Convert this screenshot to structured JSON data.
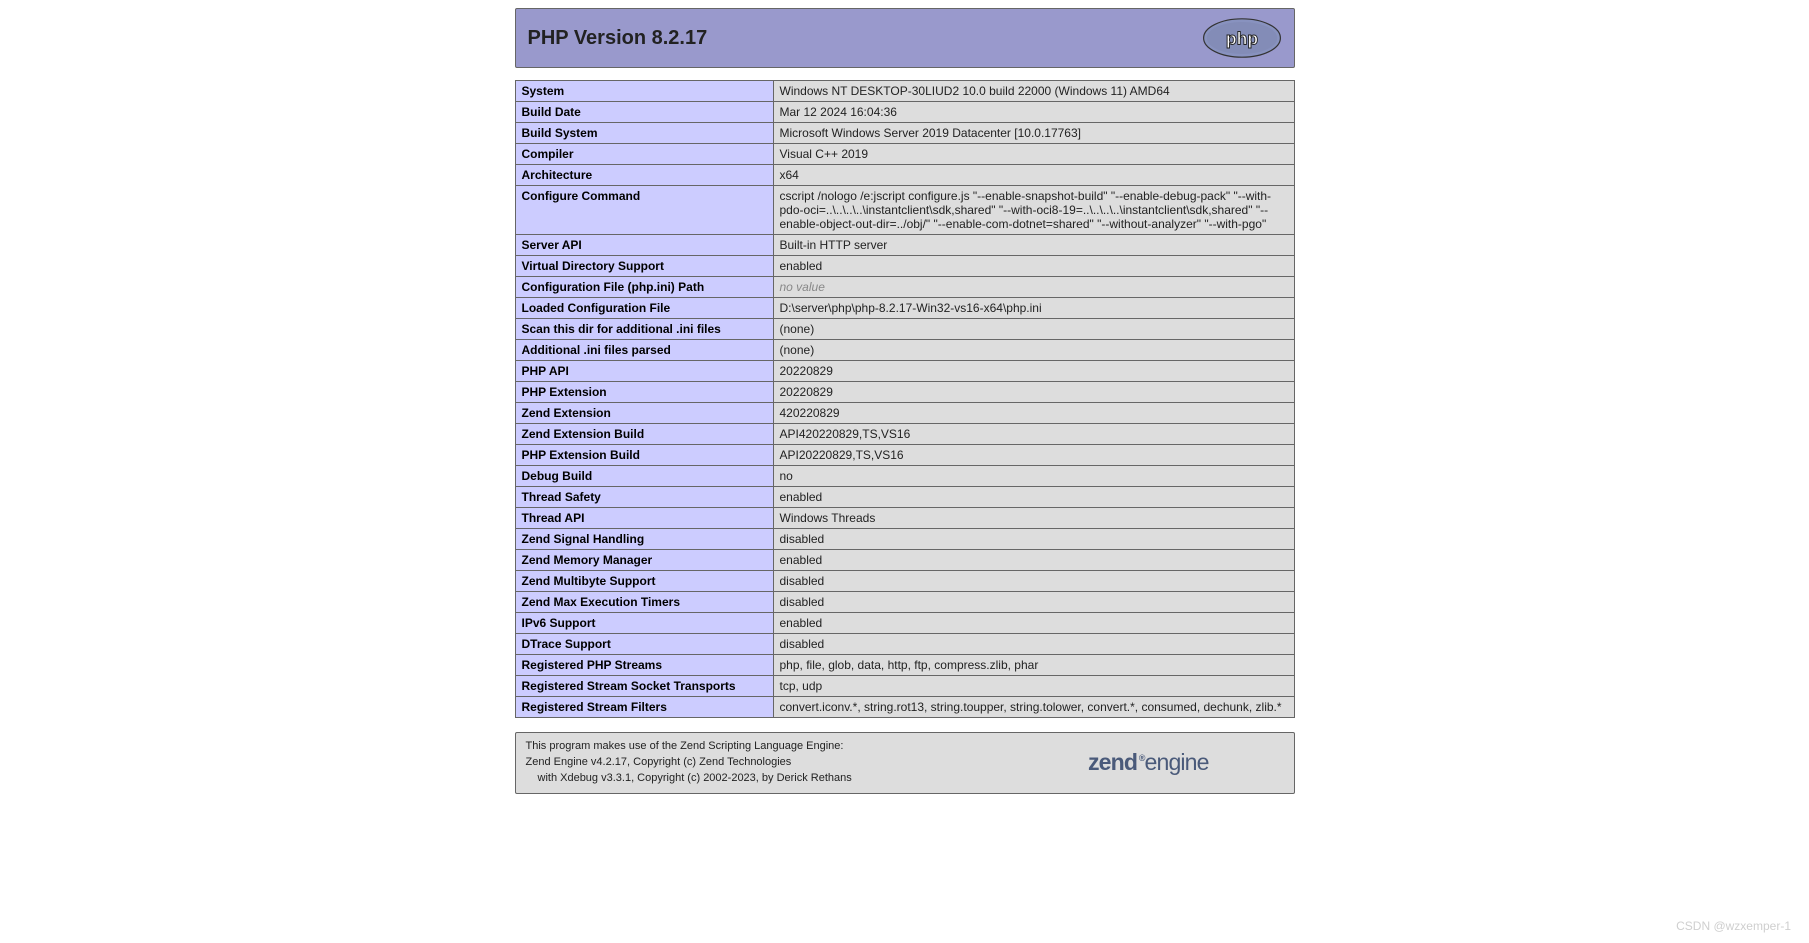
{
  "header": {
    "title": "PHP Version 8.2.17",
    "logo_text": "php"
  },
  "rows": [
    {
      "key": "System",
      "value": "Windows NT DESKTOP-30LIUD2 10.0 build 22000 (Windows 11) AMD64"
    },
    {
      "key": "Build Date",
      "value": "Mar 12 2024 16:04:36"
    },
    {
      "key": "Build System",
      "value": "Microsoft Windows Server 2019 Datacenter [10.0.17763]"
    },
    {
      "key": "Compiler",
      "value": "Visual C++ 2019"
    },
    {
      "key": "Architecture",
      "value": "x64"
    },
    {
      "key": "Configure Command",
      "value": "cscript /nologo /e:jscript configure.js \"--enable-snapshot-build\" \"--enable-debug-pack\" \"--with-pdo-oci=..\\..\\..\\..\\instantclient\\sdk,shared\" \"--with-oci8-19=..\\..\\..\\..\\instantclient\\sdk,shared\" \"--enable-object-out-dir=../obj/\" \"--enable-com-dotnet=shared\" \"--without-analyzer\" \"--with-pgo\""
    },
    {
      "key": "Server API",
      "value": "Built-in HTTP server"
    },
    {
      "key": "Virtual Directory Support",
      "value": "enabled"
    },
    {
      "key": "Configuration File (php.ini) Path",
      "value": "no value",
      "novalue": true
    },
    {
      "key": "Loaded Configuration File",
      "value": "D:\\server\\php\\php-8.2.17-Win32-vs16-x64\\php.ini"
    },
    {
      "key": "Scan this dir for additional .ini files",
      "value": "(none)"
    },
    {
      "key": "Additional .ini files parsed",
      "value": "(none)"
    },
    {
      "key": "PHP API",
      "value": "20220829"
    },
    {
      "key": "PHP Extension",
      "value": "20220829"
    },
    {
      "key": "Zend Extension",
      "value": "420220829"
    },
    {
      "key": "Zend Extension Build",
      "value": "API420220829,TS,VS16"
    },
    {
      "key": "PHP Extension Build",
      "value": "API20220829,TS,VS16"
    },
    {
      "key": "Debug Build",
      "value": "no"
    },
    {
      "key": "Thread Safety",
      "value": "enabled"
    },
    {
      "key": "Thread API",
      "value": "Windows Threads"
    },
    {
      "key": "Zend Signal Handling",
      "value": "disabled"
    },
    {
      "key": "Zend Memory Manager",
      "value": "enabled"
    },
    {
      "key": "Zend Multibyte Support",
      "value": "disabled"
    },
    {
      "key": "Zend Max Execution Timers",
      "value": "disabled"
    },
    {
      "key": "IPv6 Support",
      "value": "enabled"
    },
    {
      "key": "DTrace Support",
      "value": "disabled"
    },
    {
      "key": "Registered PHP Streams",
      "value": "php, file, glob, data, http, ftp, compress.zlib, phar"
    },
    {
      "key": "Registered Stream Socket Transports",
      "value": "tcp, udp"
    },
    {
      "key": "Registered Stream Filters",
      "value": "convert.iconv.*, string.rot13, string.toupper, string.tolower, convert.*, consumed, dechunk, zlib.*"
    }
  ],
  "zend": {
    "line1": "This program makes use of the Zend Scripting Language Engine:",
    "line2": "Zend Engine v4.2.17, Copyright (c) Zend Technologies",
    "line3": "with Xdebug v3.3.1, Copyright (c) 2002-2023, by Derick Rethans",
    "logo_text_a": "zend",
    "logo_text_b": "engine"
  },
  "watermark": "CSDN @wzxemper-1"
}
